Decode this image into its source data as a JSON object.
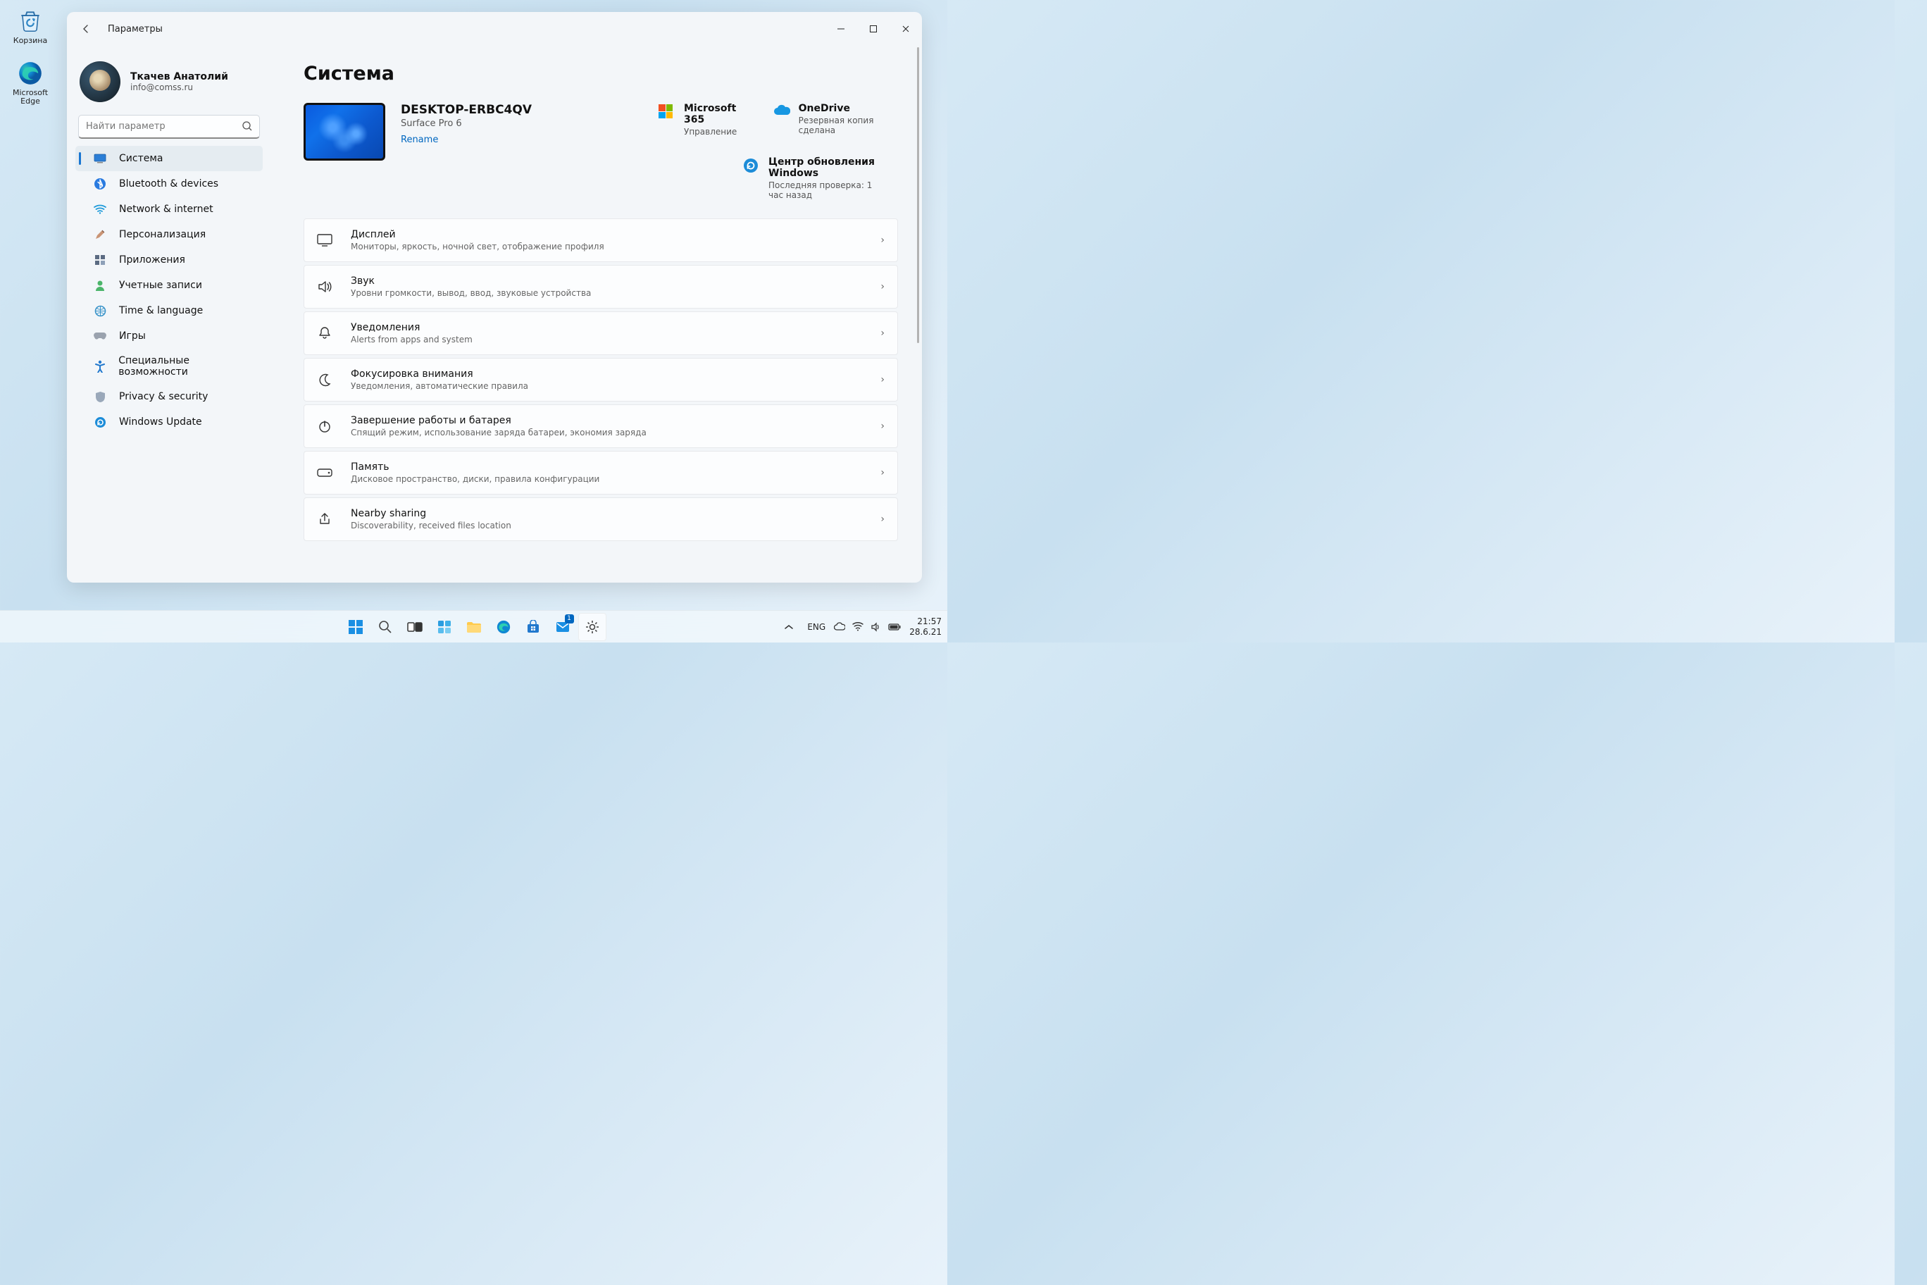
{
  "desktop": {
    "recycle_bin": "Корзина",
    "edge": "Microsoft Edge"
  },
  "window": {
    "title": "Параметры",
    "profile": {
      "name": "Ткачев Анатолий",
      "email": "info@comss.ru"
    },
    "search_placeholder": "Найти параметр",
    "nav": {
      "system": "Система",
      "bluetooth": "Bluetooth & devices",
      "network": "Network & internet",
      "personalization": "Персонализация",
      "apps": "Приложения",
      "accounts": "Учетные записи",
      "time": "Time & language",
      "gaming": "Игры",
      "accessibility": "Специальные возможности",
      "privacy": "Privacy & security",
      "update": "Windows Update"
    },
    "main": {
      "title": "Система",
      "device": {
        "name": "DESKTOP-ERBC4QV",
        "model": "Surface Pro 6",
        "rename": "Rename"
      },
      "info": {
        "ms365": {
          "title": "Microsoft 365",
          "sub": "Управление"
        },
        "onedrive": {
          "title": "OneDrive",
          "sub": "Резервная копия сделана"
        },
        "update": {
          "title": "Центр обновления Windows",
          "sub": "Последняя проверка: 1 час назад"
        }
      },
      "cards": {
        "display": {
          "title": "Дисплей",
          "sub": "Мониторы, яркость, ночной свет, отображение профиля"
        },
        "sound": {
          "title": "Звук",
          "sub": "Уровни громкости, вывод, ввод, звуковые устройства"
        },
        "notifications": {
          "title": "Уведомления",
          "sub": "Alerts from apps and system"
        },
        "focus": {
          "title": "Фокусировка внимания",
          "sub": "Уведомления, автоматические правила"
        },
        "power": {
          "title": "Завершение работы и батарея",
          "sub": "Спящий режим, использование заряда батареи, экономия заряда"
        },
        "storage": {
          "title": "Память",
          "sub": "Дисковое пространство, диски, правила конфигурации"
        },
        "nearby": {
          "title": "Nearby sharing",
          "sub": "Discoverability, received files location"
        }
      }
    }
  },
  "taskbar": {
    "lang": "ENG",
    "time": "21:57",
    "date": "28.6.21",
    "badge": "1"
  }
}
